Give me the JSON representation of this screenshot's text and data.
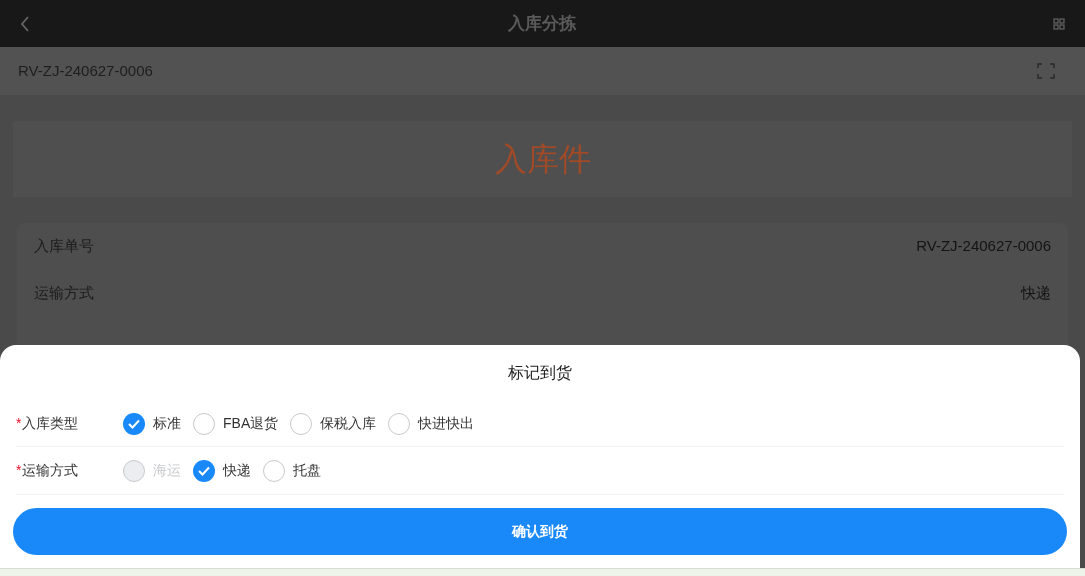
{
  "header": {
    "title": "入库分拣"
  },
  "scan_bar": {
    "value": "RV-ZJ-240627-0006"
  },
  "banner": {
    "title": "入库件"
  },
  "info_rows": [
    {
      "label": "入库单号",
      "value": "RV-ZJ-240627-0006"
    },
    {
      "label": "运输方式",
      "value": "快递"
    }
  ],
  "sheet": {
    "title": "标记到货",
    "fields": [
      {
        "label": "入库类型",
        "required_mark": "*",
        "options": [
          {
            "label": "标准",
            "selected": true,
            "disabled": false
          },
          {
            "label": "FBA退货",
            "selected": false,
            "disabled": false
          },
          {
            "label": "保税入库",
            "selected": false,
            "disabled": false
          },
          {
            "label": "快进快出",
            "selected": false,
            "disabled": false
          }
        ]
      },
      {
        "label": "运输方式",
        "required_mark": "*",
        "options": [
          {
            "label": "海运",
            "selected": false,
            "disabled": true
          },
          {
            "label": "快递",
            "selected": true,
            "disabled": false
          },
          {
            "label": "托盘",
            "selected": false,
            "disabled": false
          }
        ]
      }
    ],
    "button": "确认到货"
  }
}
